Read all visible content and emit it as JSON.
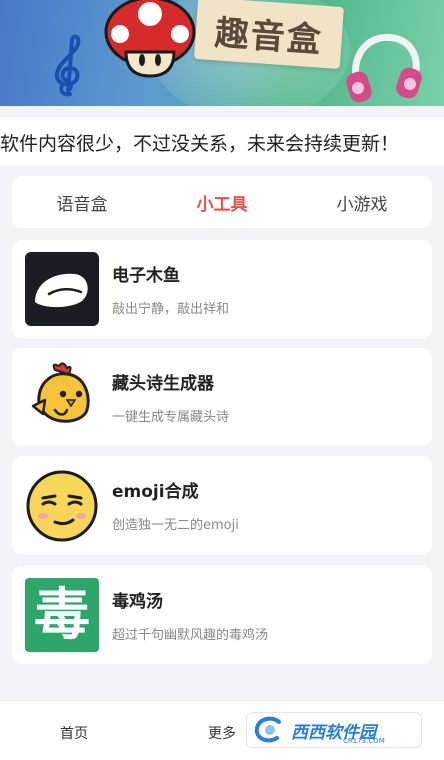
{
  "banner": {
    "title": "趣音盒"
  },
  "notice": {
    "text": "软件内容很少，不过没关系，未来会持续更新！"
  },
  "tabs": [
    {
      "label": "语音盒",
      "active": false
    },
    {
      "label": "小工具",
      "active": true
    },
    {
      "label": "小游戏",
      "active": false
    }
  ],
  "tools": [
    {
      "name": "电子木鱼",
      "desc": "敲出宁静，敲出祥和",
      "icon": "wooden-fish-icon"
    },
    {
      "name": "藏头诗生成器",
      "desc": "一键生成专属藏头诗",
      "icon": "chick-icon"
    },
    {
      "name": "emoji合成",
      "desc": "创造独一无二的emoji",
      "icon": "emoji-face-icon"
    },
    {
      "name": "毒鸡汤",
      "desc": "超过千句幽默风趣的毒鸡汤",
      "icon": "poison-icon",
      "icon_text": "毒"
    }
  ],
  "bottom_nav": {
    "home": "首页",
    "more": "更多"
  },
  "watermark": {
    "main": "西西软件园",
    "sub": "CR173.COM"
  },
  "colors": {
    "accent": "#e8504e",
    "poison_green": "#2ea56a"
  }
}
